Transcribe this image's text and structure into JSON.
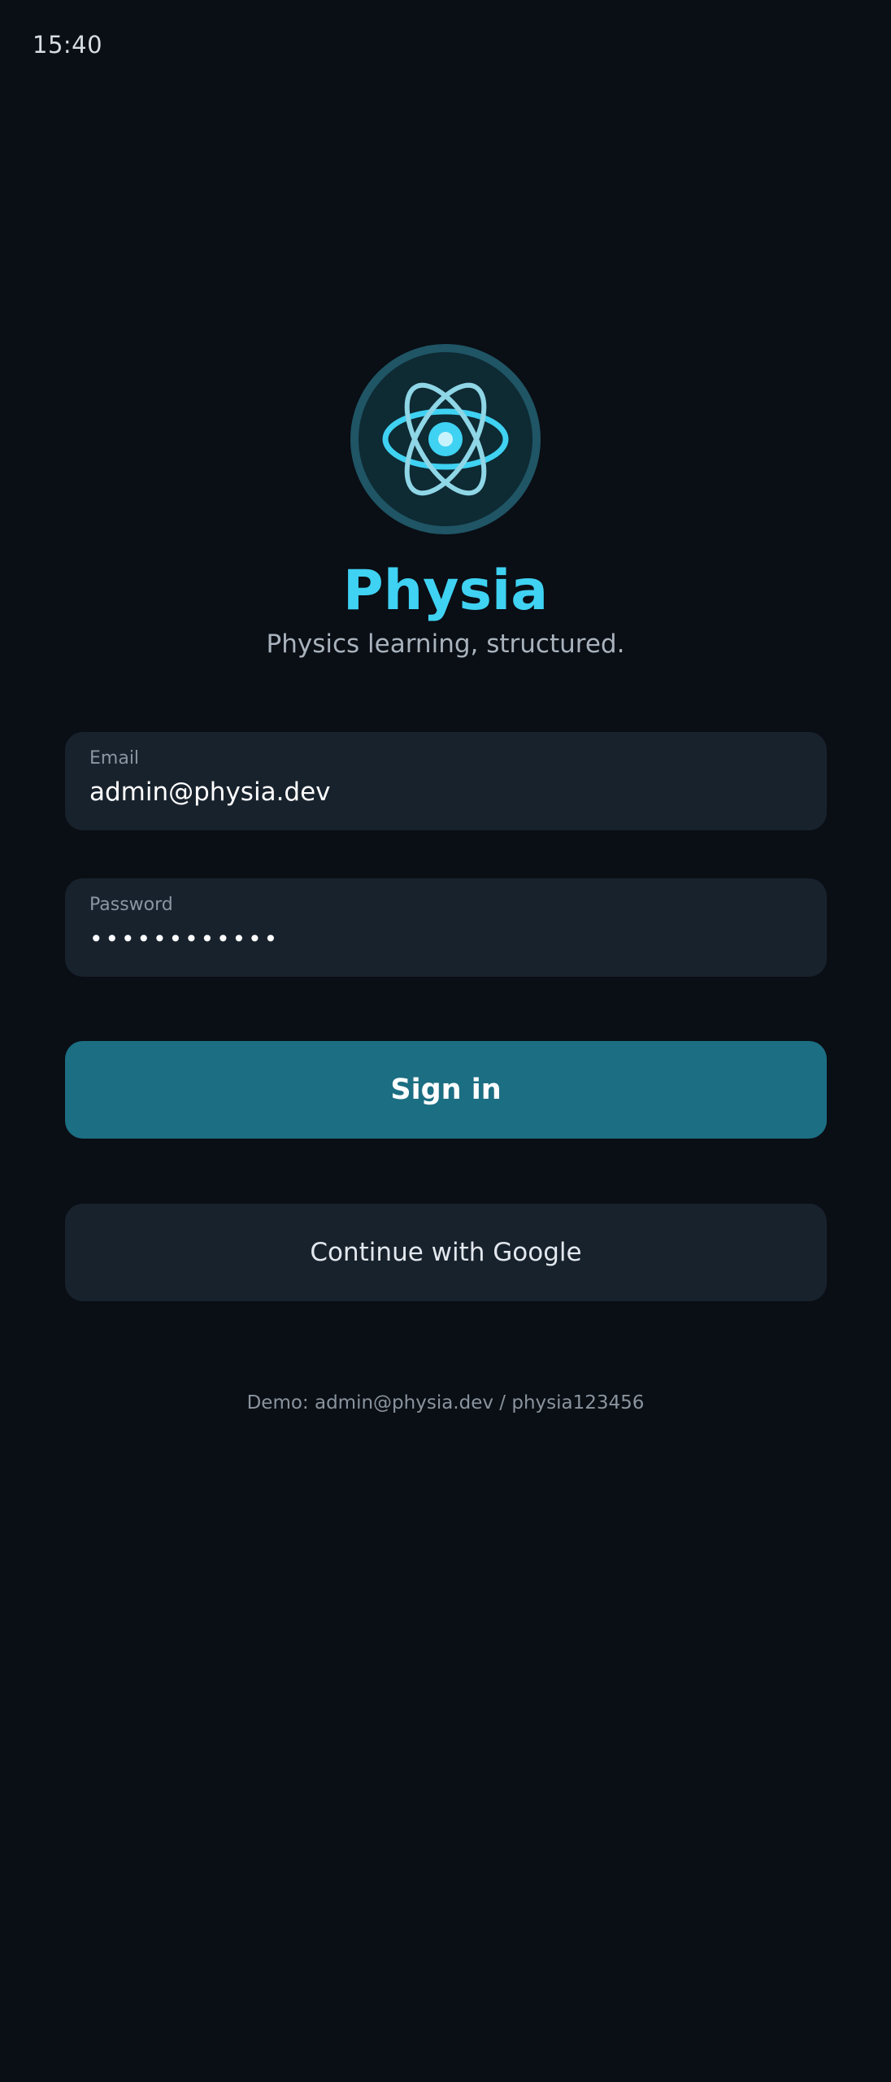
{
  "status_bar": {
    "time": "15:40"
  },
  "app": {
    "title": "Physia",
    "tagline": "Physics learning, structured.",
    "logo_icon": "atom-icon",
    "colors": {
      "accent": "#3fd2f2",
      "primary_button": "#1c6e82",
      "background": "#0a0e15",
      "field_background": "#18222d"
    }
  },
  "form": {
    "email": {
      "label": "Email",
      "value": "admin@physia.dev"
    },
    "password": {
      "label": "Password",
      "value": "••••••••••••"
    },
    "sign_in_label": "Sign in",
    "google_label": "Continue with Google"
  },
  "footer": {
    "demo_hint": "Demo: admin@physia.dev / physia123456"
  }
}
